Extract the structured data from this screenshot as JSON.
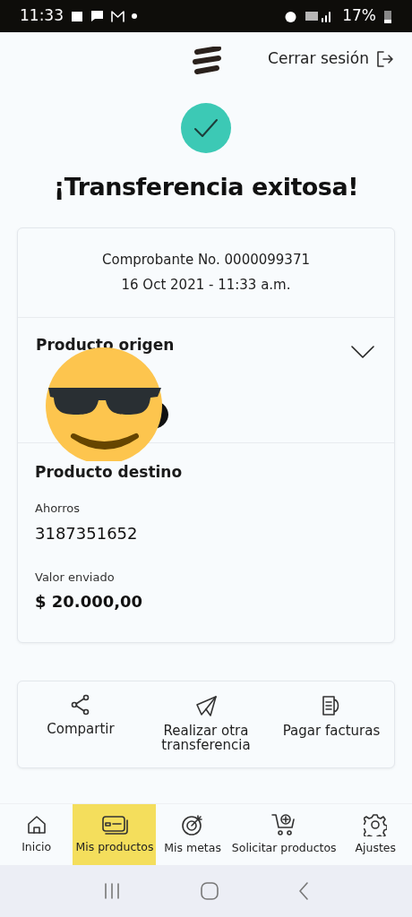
{
  "status_bar": {
    "time": "11:33",
    "battery": "17%"
  },
  "header": {
    "logout": "Cerrar sesión"
  },
  "title": "¡Transferencia exitosa!",
  "receipt": {
    "number": "Comprobante No. 0000099371",
    "date": "16 Oct 2021 - 11:33 a.m."
  },
  "origin": {
    "heading": "Producto origen",
    "expanded": false
  },
  "destination": {
    "heading": "Producto destino",
    "fields": [
      {
        "label": "Ahorros",
        "value": "3187351652"
      },
      {
        "label": "Valor enviado",
        "value": "$ 20.000,00"
      }
    ]
  },
  "actions": [
    {
      "kind": "share",
      "label": "Compartir"
    },
    {
      "kind": "send",
      "label": "Realizar otra transferencia"
    },
    {
      "kind": "bills",
      "label": "Pagar facturas"
    }
  ],
  "bottom_nav": [
    {
      "kind": "home",
      "label": "Inicio",
      "selected": false
    },
    {
      "kind": "products",
      "label": "Mis productos",
      "selected": true
    },
    {
      "kind": "goals",
      "label": "Mis metas",
      "selected": false
    },
    {
      "kind": "cart",
      "label": "Solicitar productos",
      "selected": false
    },
    {
      "kind": "settings",
      "label": "Ajustes",
      "selected": false
    }
  ]
}
